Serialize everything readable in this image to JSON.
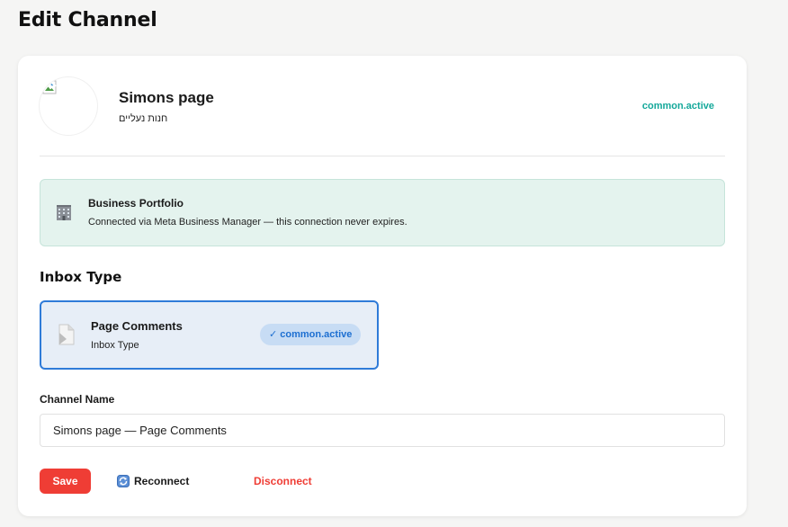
{
  "page": {
    "title": "Edit Channel"
  },
  "channel": {
    "page_name": "Simons page",
    "page_subtitle": "חנות נעליים",
    "status": "common.active",
    "avatar_icon": "broken-image-icon"
  },
  "portfolio": {
    "icon": "office-building-icon",
    "title": "Business Portfolio",
    "description": "Connected via Meta Business Manager — this connection never expires."
  },
  "inbox": {
    "section_title": "Inbox Type",
    "option": {
      "icon": "page-document-icon",
      "title": "Page Comments",
      "subtitle": "Inbox Type",
      "badge": "✓ common.active"
    }
  },
  "channel_name": {
    "label": "Channel Name",
    "value": "Simons page — Page Comments"
  },
  "actions": {
    "save_label": "Save",
    "reconnect_label": "Reconnect",
    "reconnect_icon": "refresh-icon",
    "disconnect_label": "Disconnect"
  },
  "colors": {
    "accent_blue": "#2f7bd8",
    "danger_red": "#ef3d35",
    "active_teal": "#14a89a",
    "portfolio_bg": "#e4f3ee"
  }
}
